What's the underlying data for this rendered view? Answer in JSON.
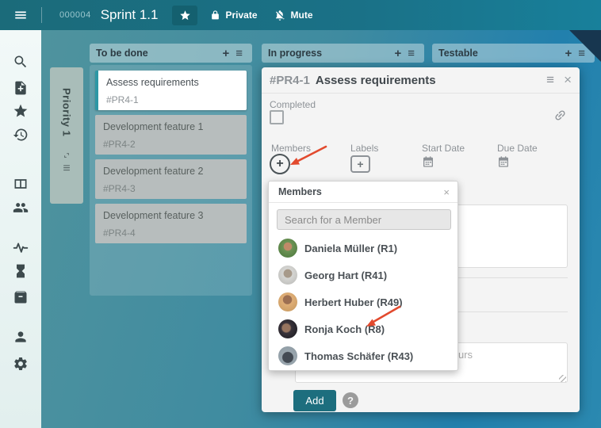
{
  "glyphs": {
    "plus": "+",
    "menu": "≡",
    "close": "×",
    "help": "?"
  },
  "colors": {
    "accent": "#1d6e7e",
    "topbar": "#1b6b7a",
    "arrow": "#e24a2e",
    "corner_fold": "#17364f"
  },
  "topbar": {
    "project_id": "000004",
    "title": "Sprint 1.1",
    "privacy_label": "Private",
    "mute_label": "Mute"
  },
  "sidebar": {
    "icons": [
      "search",
      "create-note",
      "favorites",
      "history",
      "board",
      "team",
      "activity",
      "time-tracking",
      "archive",
      "profile",
      "settings"
    ]
  },
  "board": {
    "swimlane_title": "Priority 1",
    "columns": [
      {
        "title": "To be done"
      },
      {
        "title": "In progress"
      },
      {
        "title": "Testable"
      }
    ],
    "cards": [
      {
        "title": "Assess requirements",
        "id": "#PR4-1",
        "state": "active"
      },
      {
        "title": "Development feature 1",
        "id": "#PR4-2",
        "state": "normal"
      },
      {
        "title": "Development feature 2",
        "id": "#PR4-3",
        "state": "normal"
      },
      {
        "title": "Development feature 3",
        "id": "#PR4-4",
        "state": "normal"
      }
    ]
  },
  "card_detail": {
    "id": "#PR4-1",
    "title": "Assess requirements",
    "completed_label": "Completed",
    "members_label": "Members",
    "labels_label": "Labels",
    "start_date_label": "Start Date",
    "due_date_label": "Due Date",
    "comment_placeholder_fragment": "urs",
    "add_label": "Add"
  },
  "members_popup": {
    "title": "Members",
    "search_placeholder": "Search for a Member",
    "members": [
      {
        "name": "Daniela Müller (R1)"
      },
      {
        "name": "Georg Hart (R41)"
      },
      {
        "name": "Herbert Huber (R49)"
      },
      {
        "name": "Ronja Koch (R8)"
      },
      {
        "name": "Thomas Schäfer (R43)"
      }
    ]
  }
}
